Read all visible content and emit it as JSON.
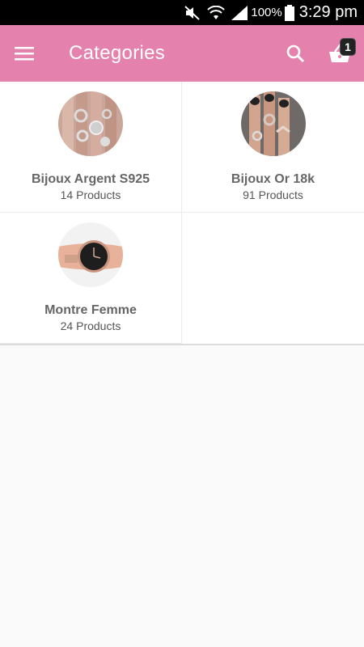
{
  "status_bar": {
    "battery_text": "100%",
    "time": "3:29 pm",
    "icons": [
      "mute-icon",
      "wifi-icon",
      "signal-icon",
      "battery-icon"
    ]
  },
  "app_bar": {
    "title": "Categories",
    "menu_icon": "hamburger-menu-icon",
    "search_icon": "search-icon",
    "cart_icon": "basket-icon",
    "cart_badge": "1",
    "background_color": "#e482ad"
  },
  "categories": [
    {
      "name": "Bijoux Argent S925",
      "count": "14 Products",
      "image": "silver-rings-photo"
    },
    {
      "name": "Bijoux Or 18k",
      "count": "91 Products",
      "image": "gold-rings-photo"
    },
    {
      "name": "Montre Femme",
      "count": "24 Products",
      "image": "rose-gold-watch-photo"
    }
  ]
}
